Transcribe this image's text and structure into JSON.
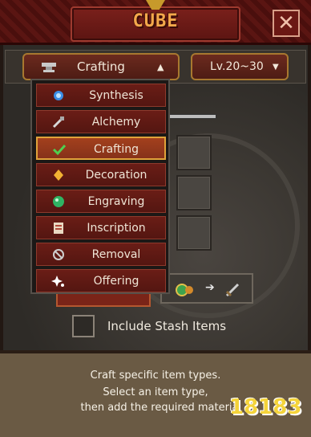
{
  "header": {
    "title": "CUBE"
  },
  "filters": {
    "category_label": "Crafting",
    "level_label": "Lv.20~30"
  },
  "menu": {
    "items": [
      {
        "label": "Synthesis",
        "icon": "synthesis-icon",
        "selected": false
      },
      {
        "label": "Alchemy",
        "icon": "alchemy-icon",
        "selected": false
      },
      {
        "label": "Crafting",
        "icon": "crafting-check-icon",
        "selected": true
      },
      {
        "label": "Decoration",
        "icon": "decoration-icon",
        "selected": false
      },
      {
        "label": "Engraving",
        "icon": "engraving-icon",
        "selected": false
      },
      {
        "label": "Inscription",
        "icon": "inscription-icon",
        "selected": false
      },
      {
        "label": "Removal",
        "icon": "removal-icon",
        "selected": false
      },
      {
        "label": "Offering",
        "icon": "offering-icon",
        "selected": false
      }
    ]
  },
  "stash": {
    "label": "Include Stash Items",
    "checked": false
  },
  "footer": {
    "lines": [
      "Craft specific item types.",
      "Select an item type,",
      "then add the required materia"
    ]
  },
  "watermark": {
    "text": "18183"
  },
  "colors": {
    "accent_gold": "#e0a23a",
    "header_red": "#5a1512",
    "title_orange": "#f4a84b"
  }
}
